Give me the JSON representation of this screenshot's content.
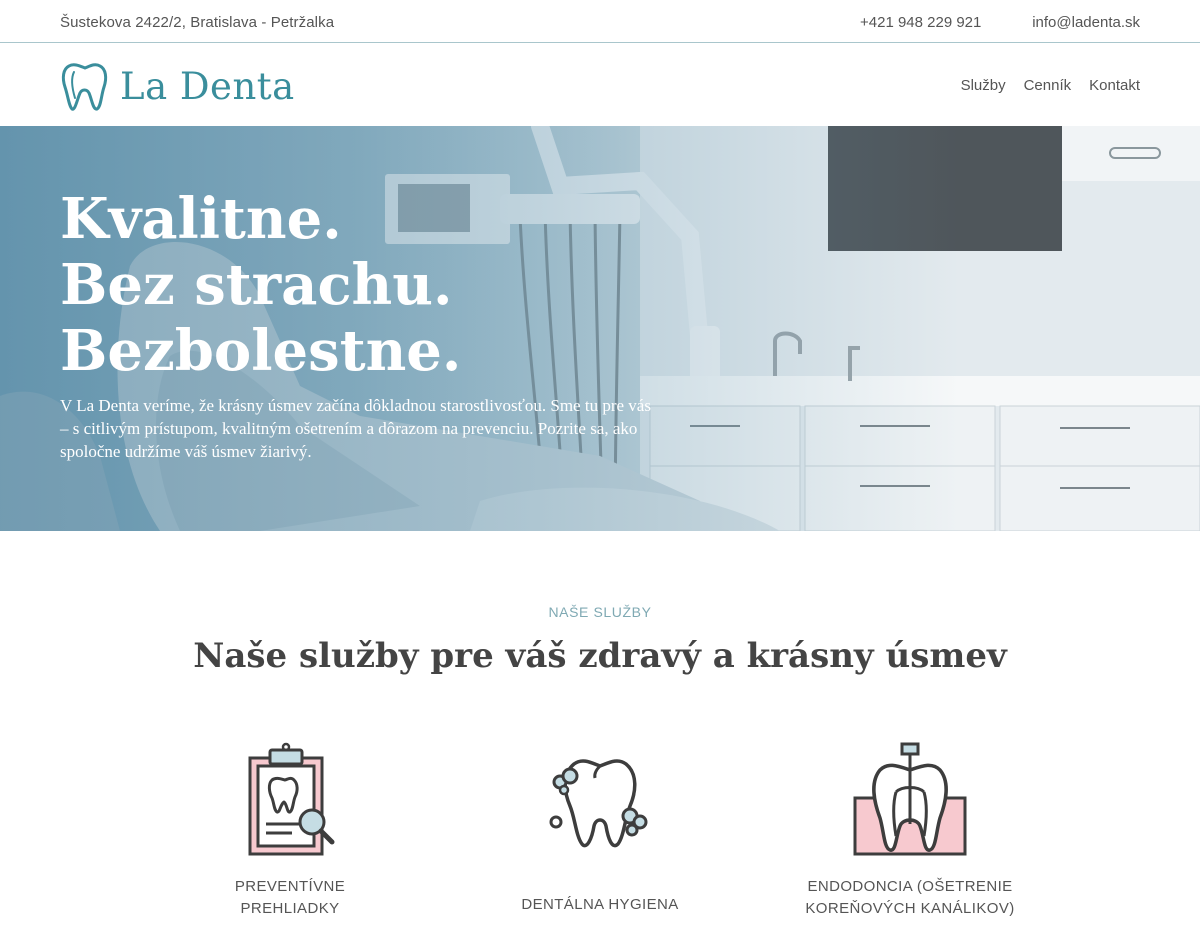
{
  "topbar": {
    "address": "Šustekova 2422/2, Bratislava - Petržalka",
    "phone": "+421 948 229 921",
    "email": "info@ladenta.sk"
  },
  "header": {
    "logo_text": "La Denta",
    "nav": [
      "Služby",
      "Cenník",
      "Kontakt"
    ]
  },
  "hero": {
    "headline": [
      "Kvalitne.",
      "Bez strachu.",
      "Bezbolestne."
    ],
    "text": "V La Denta veríme, že krásny úsmev začína dôkladnou starostlivosťou. Sme tu pre vás – s citlivým prístupom, kvalitným ošetrením a dôrazom na prevenciu. Pozrite sa, ako spoločne udržíme váš úsmev žiarivý."
  },
  "services": {
    "kicker": "NAŠE SLUŽBY",
    "title": "Naše služby pre váš zdravý a krásny úsmev",
    "items": [
      {
        "label": "PREVENTÍVNE PREHLIADKY",
        "icon": "clipboard-tooth-icon"
      },
      {
        "label": "DENTÁLNA HYGIENA",
        "icon": "clean-tooth-icon"
      },
      {
        "label": "ENDODONCIA (OŠETRENIE KOREŇOVÝCH KANÁLIKOV)",
        "icon": "root-canal-icon"
      }
    ]
  },
  "colors": {
    "accent": "#3a8e9c",
    "pink": "#f7c9cf",
    "icon_stroke": "#3d3d3d"
  }
}
